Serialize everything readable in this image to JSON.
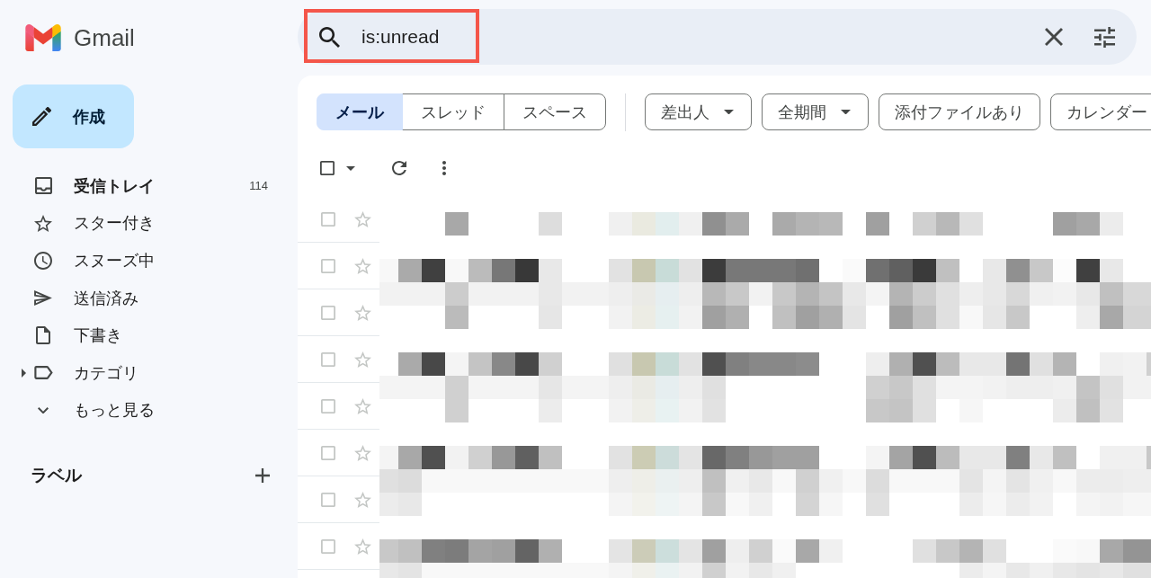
{
  "app": {
    "name": "Gmail"
  },
  "compose": {
    "label": "作成"
  },
  "sidebar": {
    "items": [
      {
        "kind": "inbox",
        "label": "受信トレイ",
        "count": "114",
        "unread": true,
        "selected": false
      },
      {
        "kind": "starred",
        "label": "スター付き",
        "unread": false,
        "selected": false
      },
      {
        "kind": "snoozed",
        "label": "スヌーズ中",
        "unread": false,
        "selected": false
      },
      {
        "kind": "sent",
        "label": "送信済み",
        "unread": false,
        "selected": false
      },
      {
        "kind": "drafts",
        "label": "下書き",
        "unread": false,
        "selected": false
      },
      {
        "kind": "categories",
        "label": "カテゴリ",
        "expanded": false,
        "unread": false,
        "selected": false
      },
      {
        "kind": "more",
        "label": "もっと見る",
        "unread": false,
        "selected": false
      }
    ],
    "labels_heading": "ラベル"
  },
  "search": {
    "value": "is:unread",
    "highlighted": true
  },
  "view_tabs": [
    {
      "label": "メール",
      "selected": true
    },
    {
      "label": "スレッド",
      "selected": false
    },
    {
      "label": "スペース",
      "selected": false
    }
  ],
  "filters": [
    {
      "label": "差出人",
      "dropdown": true
    },
    {
      "label": "全期間",
      "dropdown": true
    },
    {
      "label": "添付ファイルあり",
      "dropdown": false
    },
    {
      "label": "カレンダー",
      "dropdown": false
    }
  ],
  "list_toolbar": {
    "select_all_checked": false
  },
  "messages": [
    {
      "checked": false,
      "starred": false
    },
    {
      "checked": false,
      "starred": false
    },
    {
      "checked": false,
      "starred": false
    },
    {
      "checked": false,
      "starred": false
    },
    {
      "checked": false,
      "starred": false
    },
    {
      "checked": false,
      "starred": false
    },
    {
      "checked": false,
      "starred": false
    },
    {
      "checked": false,
      "starred": false
    }
  ]
}
